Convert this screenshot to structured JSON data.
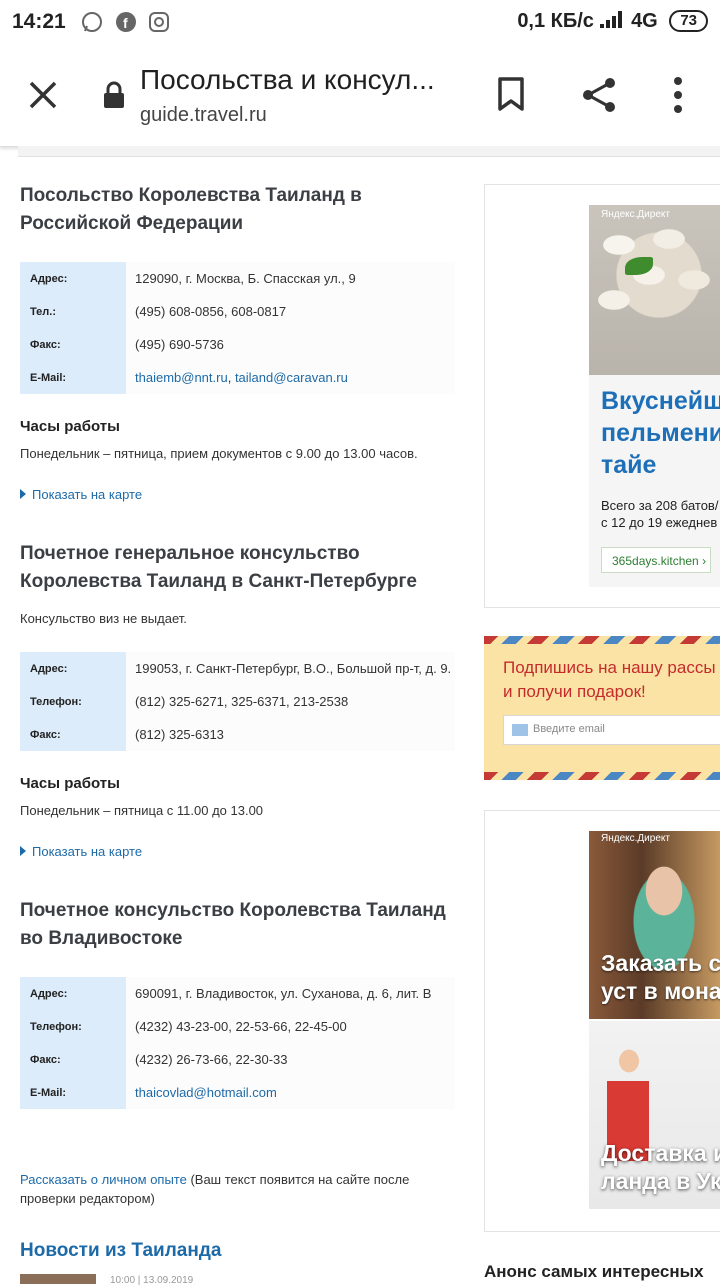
{
  "status_bar": {
    "time": "14:21",
    "icons": [
      "whatsapp-icon",
      "facebook-icon",
      "instagram-icon"
    ],
    "net_speed": "0,1 КБ/с",
    "network": "4G",
    "battery": "73"
  },
  "browser": {
    "title": "Посольства и консул...",
    "url": "guide.travel.ru"
  },
  "sections": [
    {
      "title": "Посольство Королевства Таиланд в Российской Федерации",
      "rows": [
        {
          "label": "Адрес:",
          "value": "129090, г. Москва, Б. Спасская ул., 9"
        },
        {
          "label": "Тел.:",
          "value": "(495) 608-0856, 608-0817"
        },
        {
          "label": "Факс:",
          "value": "(495) 690-5736"
        },
        {
          "label": "E-Mail:",
          "email1": "thaiemb@nnt.ru",
          "sep": ", ",
          "email2": "tailand@caravan.ru"
        }
      ],
      "hours_title": "Часы работы",
      "hours": "Понедельник – пятница, прием документов с 9.00 до 13.00 часов.",
      "map_link": "Показать на карте"
    },
    {
      "title": "Почетное генеральное консульство Королевства Таиланд в Санкт-Петербурге",
      "note": "Консульство виз не выдает.",
      "rows": [
        {
          "label": "Адрес:",
          "value": "199053, г. Санкт-Петербург, В.О., Большой пр-т, д. 9."
        },
        {
          "label": "Телефон:",
          "value": "(812) 325-6271, 325-6371, 213-2538"
        },
        {
          "label": "Факс:",
          "value": "(812) 325-6313"
        }
      ],
      "hours_title": "Часы работы",
      "hours": "Понедельник – пятница с 11.00 до 13.00",
      "map_link": "Показать на карте"
    },
    {
      "title": "Почетное консульство Королевства Таиланд во Владивостоке",
      "rows": [
        {
          "label": "Адрес:",
          "value": "690091, г. Владивосток, ул. Суханова, д. 6, лит. В"
        },
        {
          "label": "Телефон:",
          "value": "(4232) 43-23-00, 22-53-66, 22-45-00"
        },
        {
          "label": "Факс:",
          "value": "(4232) 26-73-66, 22-30-33"
        },
        {
          "label": "E-Mail:",
          "email1": "thaicovlad@hotmail.com"
        }
      ]
    }
  ],
  "experience": {
    "link": "Рассказать о личном опыте",
    "note": " (Ваш текст появится на сайте после проверки редактором)"
  },
  "news": {
    "title": "Новости из Таиланда",
    "meta": "10:00 | 13.09.2019"
  },
  "ad1": {
    "label": "Яндекс.Директ",
    "headline_1": "Вкуснейш",
    "headline_2": "пельмени",
    "headline_3": "тайе",
    "text_1": "Всего за 208 батов/",
    "text_2": "с 12 до 19 ежеднев",
    "button": "365days.kitchen"
  },
  "promo": {
    "line1": "Подпишись на нашу рассы",
    "line2": "и получи подарок!",
    "placeholder": "Введите email"
  },
  "ad2": {
    "label": "Яндекс.Директ",
    "headline1_a": "Заказать с",
    "headline1_b": "уст в монас",
    "headline2_a": "Доставка и",
    "headline2_b": "ланда в Ук"
  },
  "anons": "Анонс самых интересных"
}
